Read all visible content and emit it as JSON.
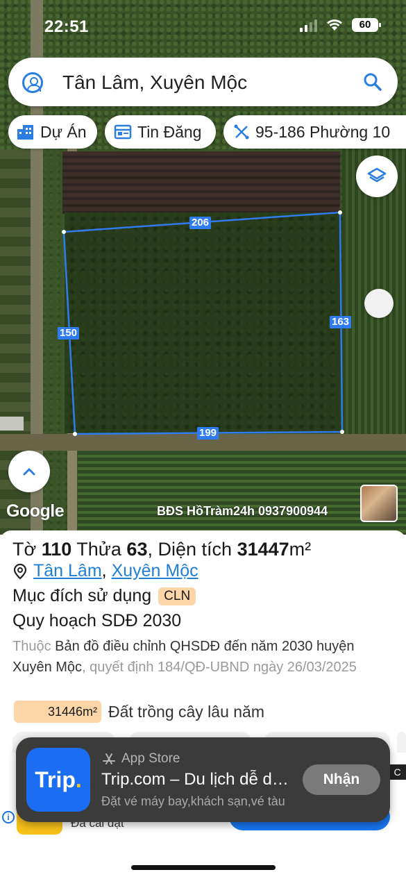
{
  "status_bar": {
    "time": "22:51",
    "battery": "60"
  },
  "search": {
    "query": "Tân Lâm, Xuyên Mộc"
  },
  "chips": [
    {
      "label": "Dự Án",
      "icon": "building-icon"
    },
    {
      "label": "Tin Đăng",
      "icon": "listing-icon"
    },
    {
      "label": "95-186 Phường 10",
      "icon": "ruler-icon"
    }
  ],
  "map": {
    "dimensions": {
      "top": "206",
      "right": "163",
      "left": "150",
      "bottom": "199"
    },
    "attribution": "Google",
    "watermark": "BĐS HồTràm24h 0937900944"
  },
  "parcel": {
    "to_label": "Tờ",
    "to_value": "110",
    "thua_label": "Thửa",
    "thua_value": "63",
    "area_label": "Diện tích",
    "area_value": "31447",
    "area_unit": "m²",
    "ward": "Tân Lâm",
    "district": "Xuyên Mộc",
    "purpose_label": "Mục đích sử dụng",
    "purpose_code": "CLN",
    "plan_title": "Quy hoạch SDĐ 2030",
    "plan_prefix": "Thuộc",
    "plan_name": "Bản đồ điều chỉnh QHSDĐ đến năm 2030 huyện Xuyên Mộc",
    "plan_suffix": ", quyết định 184/QĐ-UBND ngày 26/03/2025",
    "zone_area": "31446m²",
    "zone_label": "Đất trồng cây lâu năm"
  },
  "ad": {
    "logo_text": "Trip",
    "logo_dot": ".",
    "store": "App Store",
    "title": "Trip.com – Du lịch dễ dàng",
    "subtitle": "Đặt vé máy bay,khách sạn,vé tàu",
    "cta": "Nhận",
    "installed": "Đã cài đặt",
    "close": "C",
    "info": "i"
  },
  "colors": {
    "accent": "#2a7de1",
    "boundary": "#2f7cf0",
    "badge": "#fcd6a8"
  }
}
